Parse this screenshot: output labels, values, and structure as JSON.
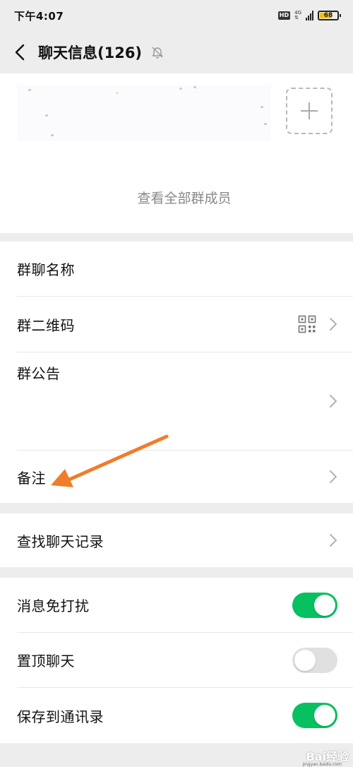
{
  "status_bar": {
    "time": "下午4:07",
    "hd_label": "HD",
    "network_label": "4G",
    "battery_level": "68"
  },
  "header": {
    "title": "聊天信息(126)"
  },
  "members": {
    "view_all_label": "查看全部群成员"
  },
  "settings_group_1": {
    "group_name_label": "群聊名称",
    "qr_code_label": "群二维码",
    "announcement_label": "群公告",
    "remark_label": "备注"
  },
  "settings_group_2": {
    "search_history_label": "查找聊天记录"
  },
  "settings_group_3": {
    "mute_label": "消息免打扰",
    "mute_on": true,
    "pin_label": "置顶聊天",
    "pin_on": false,
    "save_contacts_label": "保存到通讯录",
    "save_contacts_on": true
  },
  "annotation": {
    "arrow_color": "#f07d2a"
  },
  "watermark": {
    "text": "Bai经验",
    "subtext": "jingyan.baidu.com"
  }
}
